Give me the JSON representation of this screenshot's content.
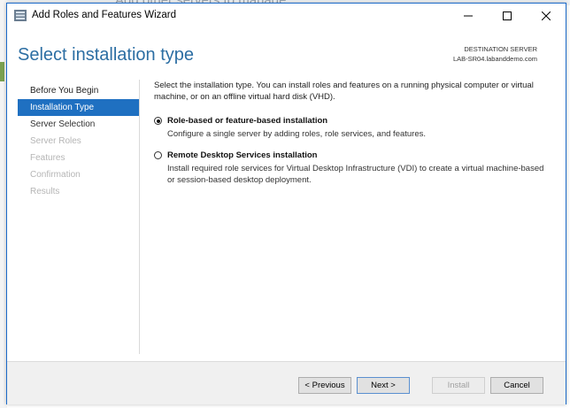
{
  "window": {
    "title": "Add Roles and Features Wizard",
    "controls": {
      "minimize": "minimize",
      "maximize": "maximize",
      "close": "close"
    }
  },
  "background": {
    "ghost_text": "Add other servers to manage"
  },
  "header": {
    "page_title": "Select installation type",
    "destination_label": "DESTINATION SERVER",
    "destination_server": "LAB-SR04.labanddemo.com"
  },
  "nav": {
    "items": [
      {
        "label": "Before You Begin",
        "state": "done"
      },
      {
        "label": "Installation Type",
        "state": "active"
      },
      {
        "label": "Server Selection",
        "state": "next"
      },
      {
        "label": "Server Roles",
        "state": "disabled"
      },
      {
        "label": "Features",
        "state": "disabled"
      },
      {
        "label": "Confirmation",
        "state": "disabled"
      },
      {
        "label": "Results",
        "state": "disabled"
      }
    ]
  },
  "content": {
    "intro": "Select the installation type. You can install roles and features on a running physical computer or virtual machine, or on an offline virtual hard disk (VHD).",
    "options": [
      {
        "label": "Role-based or feature-based installation",
        "description": "Configure a single server by adding roles, role services, and features.",
        "selected": true
      },
      {
        "label": "Remote Desktop Services installation",
        "description": "Install required role services for Virtual Desktop Infrastructure (VDI) to create a virtual machine-based or session-based desktop deployment.",
        "selected": false
      }
    ]
  },
  "footer": {
    "previous_label": "< Previous",
    "next_label": "Next >",
    "install_label": "Install",
    "cancel_label": "Cancel"
  },
  "colors": {
    "accent": "#1f70c1",
    "title_blue": "#2c6ea3",
    "disabled_text": "#b5b5b5"
  }
}
